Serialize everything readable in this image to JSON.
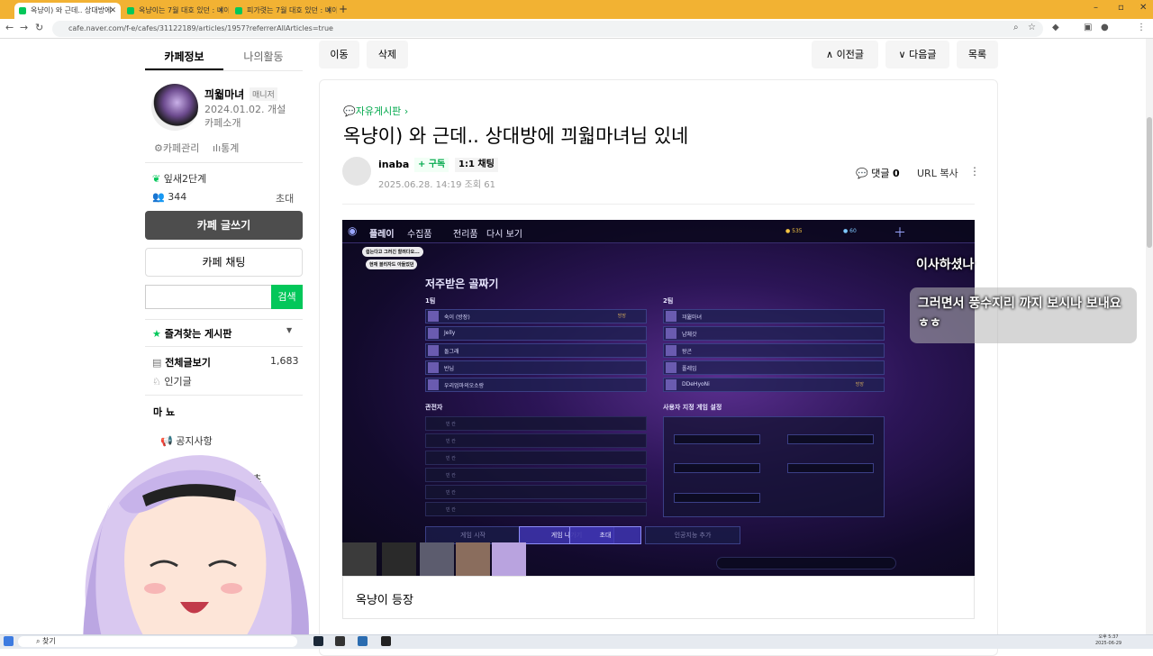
{
  "browser": {
    "tabs": [
      {
        "title": "옥냥이) 와 근데.. 상대방에"
      },
      {
        "title": "옥냥이는 7월 대호 있던 : 네이"
      },
      {
        "title": "피가렷는 7월 대호 있던 : 네이"
      }
    ],
    "url": "cafe.naver.com/f-e/cafes/31122189/articles/1957?referrerAllArticles=true"
  },
  "sidebar": {
    "tab_info": "카페정보",
    "tab_activity": "나의활동",
    "manager_name": "끠웗마녀",
    "manager_badge": "매니저",
    "founded": "2024.01.02. 개설",
    "cafe_intro": "카페소개",
    "cafe_manage": "카페관리",
    "stats": "통계",
    "level": "잎새2단계",
    "member_count": "344",
    "invite": "초대",
    "write_button": "카페 글쓰기",
    "chat_button": "카페 채팅",
    "search_placeholder": "",
    "search_button": "검색",
    "favorites_header": "즐겨찾는 게시판",
    "all_posts": "전체글보기",
    "all_posts_count": "1,683",
    "popular": "인기글",
    "category": "마 뇨",
    "notice": "공지사항",
    "content": "컨텐츠"
  },
  "toolbar": {
    "move": "이동",
    "delete": "삭제",
    "prev": "이전글",
    "next": "다음글",
    "list": "목록"
  },
  "article": {
    "board": "자유게시판",
    "title": "옥냥이) 와 근데.. 상대방에 끠웗마녀님 있네",
    "author": "inaba",
    "subscribe": "+ 구독",
    "chat": "1:1 채팅",
    "date": "2025.06.28. 14:19",
    "views": "조회 61",
    "comments_label": "댓글",
    "comments_count": "0",
    "url_copy": "URL 복사",
    "caption": "옥냥이 등장"
  },
  "game": {
    "nav_play": "플레이",
    "nav_collection": "수집품",
    "nav_hall": "전리품",
    "nav_replay": "다시 보기",
    "gold": "535",
    "gems": "60",
    "lobby_title": "저주받은 골짜기",
    "team1": "1팀",
    "team2": "2팀",
    "team1_players": [
      "숙이 (방장)",
      "Jelly",
      "돌그래",
      "반님",
      "우리엄마의오소랑"
    ],
    "team2_players": [
      "끠웗마녀",
      "냠체갓",
      "왕곤",
      "폴레임",
      "DDeHyoNi"
    ],
    "host_tag": "방장",
    "observer_header": "관전자",
    "observer_slot": "빈 칸",
    "settings_header": "사용자 지정 게임 설정",
    "btn_start": "게임 시작",
    "btn_leave": "게임 나가기",
    "btn_invite": "초대",
    "btn_ai": "인공지능 추가",
    "bubble1": "쉽는다고 그러긴 할려다오...",
    "bubble2": "현재 블리자드 아들었던"
  },
  "stream_overlay": {
    "caption_top": "이사하셨나",
    "caption_main": "그러면서 풍수지리 까지 보시나 보내요 ㅎㅎ"
  },
  "taskbar": {
    "search": "찾기",
    "time": "오후 5:37",
    "date": "2025-06-29"
  }
}
